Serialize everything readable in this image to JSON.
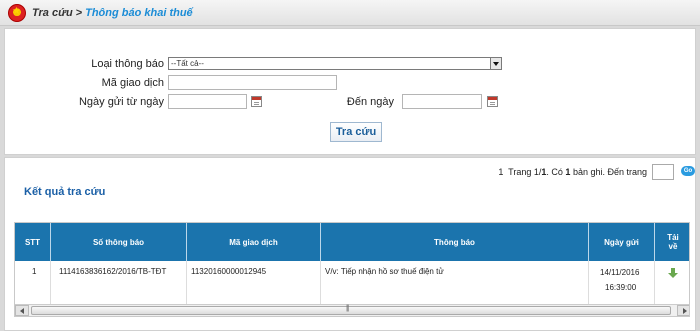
{
  "breadcrumb": {
    "root": "Tra cứu",
    "separator": ">",
    "current": "Thông báo khai thuế"
  },
  "form": {
    "notice_type_label": "Loại thông báo",
    "notice_type_value": "--Tất cả--",
    "transaction_code_label": "Mã giao dịch",
    "transaction_code_value": "",
    "from_date_label": "Ngày gửi từ ngày",
    "from_date_value": "",
    "to_date_label": "Đến ngày",
    "to_date_value": "",
    "search_button": "Tra cứu"
  },
  "pager": {
    "page_text_1": "1",
    "page_text_2": "Trang 1/",
    "total_pages": "1",
    "records_prefix": ". Có",
    "records_count": "1",
    "records_suffix": "bản ghi. Đến trang",
    "go_label": "Go"
  },
  "results": {
    "title": "Kết quả tra cứu",
    "columns": [
      "STT",
      "Số thông báo",
      "Mã giao dịch",
      "Thông báo",
      "Ngày gửi",
      "Tải về"
    ],
    "rows": [
      {
        "stt": "1",
        "notice_no": "1114163836162/2016/TB-TĐT",
        "transaction_code": "11320160000012945",
        "notice": "V/v: Tiếp nhận hồ sơ thuế điện tử",
        "sent_date": "14/11/2016",
        "sent_time": "16:39:00"
      }
    ]
  },
  "colors": {
    "header_blue": "#1b74ad",
    "link_blue": "#1b8cd6",
    "title_blue": "#1a5fa6",
    "download_green": "#6aa84f"
  },
  "icons": {
    "emblem": "national-emblem-icon",
    "calendar": "calendar-icon",
    "download": "download-icon",
    "dropdown": "chevron-down-icon"
  }
}
